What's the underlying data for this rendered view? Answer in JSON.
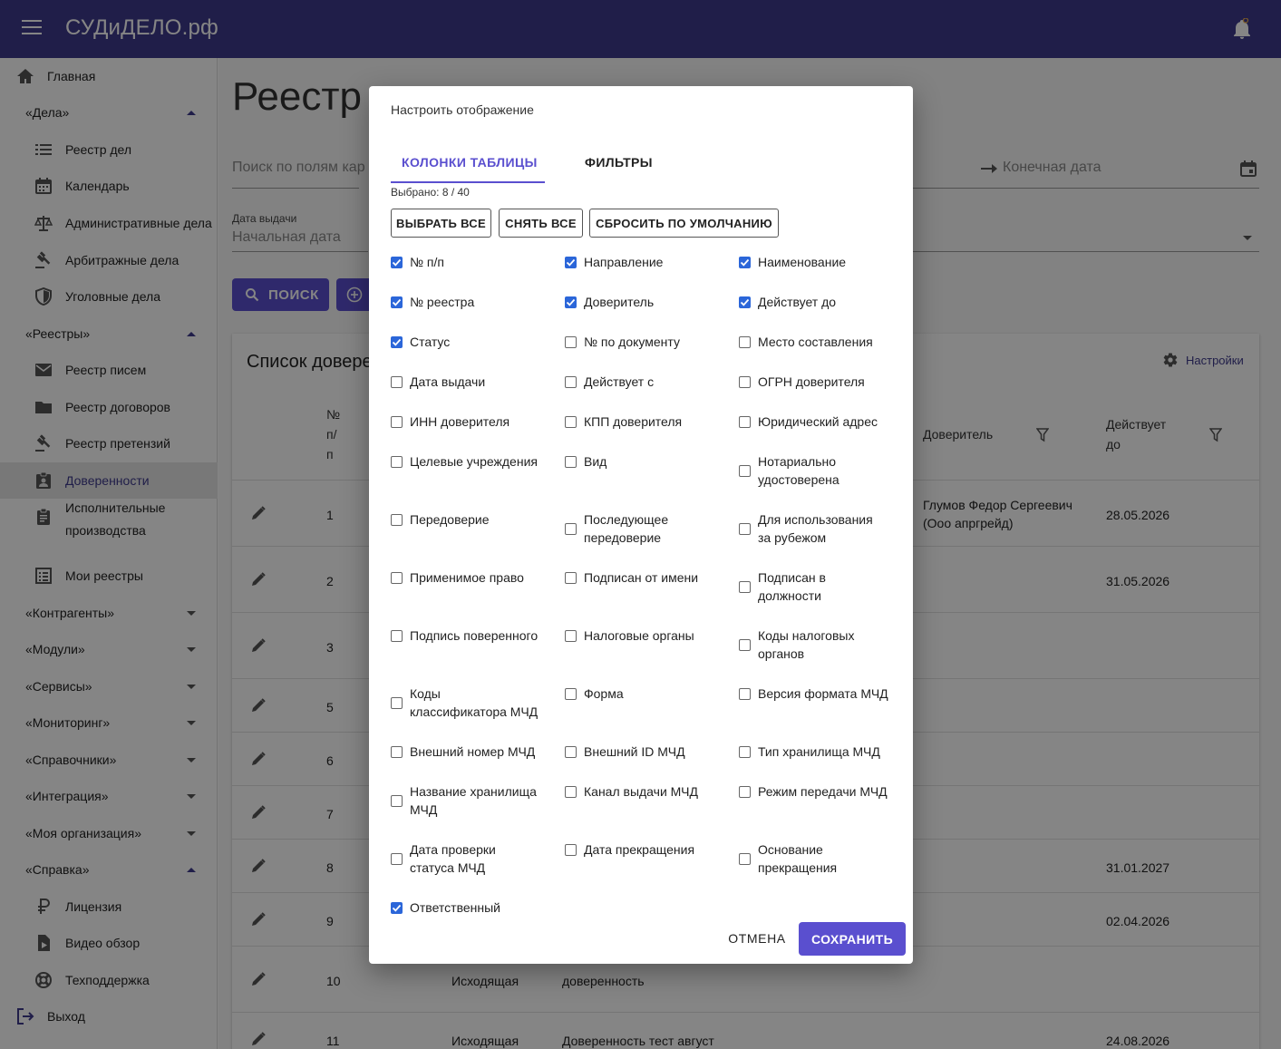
{
  "app": {
    "title": "СУДиДЕЛО.рф"
  },
  "sidebar": {
    "items": [
      {
        "label": "Главная",
        "icon": "home-icon"
      },
      {
        "label": "«Дела»",
        "icon": ""
      },
      {
        "label": "Реестр дел",
        "icon": "list-icon"
      },
      {
        "label": "Календарь",
        "icon": "calendar-icon"
      },
      {
        "label": "Административные дела",
        "icon": "scales-icon"
      },
      {
        "label": "Арбитражные дела",
        "icon": "gavel-icon"
      },
      {
        "label": "Уголовные дела",
        "icon": "shield-icon"
      },
      {
        "label": "«Реестры»",
        "icon": ""
      },
      {
        "label": "Реестр писем",
        "icon": "mail-icon"
      },
      {
        "label": "Реестр договоров",
        "icon": "folder-icon"
      },
      {
        "label": "Реестр претензий",
        "icon": "gavel-icon"
      },
      {
        "label": "Доверенности",
        "icon": "badge-icon"
      },
      {
        "label": "Исполнительные\nпроизводства",
        "icon": "clipboard-icon"
      },
      {
        "label": "Мои реестры",
        "icon": "list-box-icon"
      },
      {
        "label": "«Контрагенты»",
        "icon": ""
      },
      {
        "label": "«Модули»",
        "icon": ""
      },
      {
        "label": "«Сервисы»",
        "icon": ""
      },
      {
        "label": "«Мониторинг»",
        "icon": ""
      },
      {
        "label": "«Справочники»",
        "icon": ""
      },
      {
        "label": "«Интеграция»",
        "icon": ""
      },
      {
        "label": "«Моя организация»",
        "icon": ""
      },
      {
        "label": "«Справка»",
        "icon": ""
      },
      {
        "label": "Лицензия",
        "icon": "ruble-icon"
      },
      {
        "label": "Видео обзор",
        "icon": "video-file-icon"
      },
      {
        "label": "Техподдержка",
        "icon": "lifebuoy-icon"
      },
      {
        "label": "Выход",
        "icon": "logout-icon"
      }
    ]
  },
  "main": {
    "title": "Реестр д",
    "search_placeholder": "Поиск по полям кар",
    "end_date_placeholder": "Конечная дата",
    "issue_date_label": "Дата выдачи",
    "start_date_placeholder": "Начальная дата",
    "search_button": "ПОИСК",
    "list_title": "Список довере",
    "settings_link": "Настройки",
    "columns": {
      "num": "№\nп/\nп",
      "principal": "Доверитель",
      "valid_until": "Действует\nдо"
    },
    "rows": [
      {
        "num": "1",
        "direction": "",
        "name": "",
        "principal": "Глумов Федор Сергеевич\n(Ооо апргрейд)",
        "valid_until": "28.05.2026"
      },
      {
        "num": "2",
        "direction": "",
        "name": "",
        "principal": "",
        "valid_until": "31.05.2026"
      },
      {
        "num": "3",
        "direction": "",
        "name": "",
        "principal": "",
        "valid_until": ""
      },
      {
        "num": "5",
        "direction": "",
        "name": "",
        "principal": "",
        "valid_until": ""
      },
      {
        "num": "6",
        "direction": "",
        "name": "",
        "principal": "",
        "valid_until": ""
      },
      {
        "num": "7",
        "direction": "",
        "name": "",
        "principal": "",
        "valid_until": ""
      },
      {
        "num": "8",
        "direction": "",
        "name": "",
        "principal": "",
        "valid_until": "31.01.2027"
      },
      {
        "num": "9",
        "direction": "",
        "name": "",
        "principal": "",
        "valid_until": "02.04.2026"
      },
      {
        "num": "10",
        "direction": "Исходящая",
        "name": "доверенность",
        "principal": "",
        "valid_until": ""
      },
      {
        "num": "11",
        "direction": "Исходящая",
        "name": "Доверенность тест август",
        "principal": "",
        "valid_until": "24.08.2026"
      }
    ]
  },
  "dialog": {
    "title": "Настроить отображение",
    "tabs": [
      "КОЛОНКИ ТАБЛИЦЫ",
      "ФИЛЬТРЫ"
    ],
    "selected_text": "Выбрано: 8 / 40",
    "buttons": {
      "select_all": "ВЫБРАТЬ ВСЕ",
      "clear_all": "СНЯТЬ ВСЕ",
      "reset": "СБРОСИТЬ ПО УМОЛЧАНИЮ",
      "cancel": "ОТМЕНА",
      "save": "СОХРАНИТЬ"
    },
    "columns": [
      {
        "label": "№ п/п",
        "checked": true
      },
      {
        "label": "Направление",
        "checked": true
      },
      {
        "label": "Наименование",
        "checked": true
      },
      {
        "label": "№ реестра",
        "checked": true
      },
      {
        "label": "Доверитель",
        "checked": true
      },
      {
        "label": "Действует до",
        "checked": true
      },
      {
        "label": "Статус",
        "checked": true
      },
      {
        "label": "№ по документу",
        "checked": false
      },
      {
        "label": "Место составления",
        "checked": false
      },
      {
        "label": "Дата выдачи",
        "checked": false
      },
      {
        "label": "Действует с",
        "checked": false
      },
      {
        "label": "ОГРН доверителя",
        "checked": false
      },
      {
        "label": "ИНН доверителя",
        "checked": false
      },
      {
        "label": "КПП доверителя",
        "checked": false
      },
      {
        "label": "Юридический адрес",
        "checked": false
      },
      {
        "label": "Целевые учреждения",
        "checked": false
      },
      {
        "label": "Вид",
        "checked": false
      },
      {
        "label": "Нотариально\nудостоверена",
        "checked": false
      },
      {
        "label": "Передоверие",
        "checked": false
      },
      {
        "label": "Последующее\nпередоверие",
        "checked": false
      },
      {
        "label": "Для использования\nза рубежом",
        "checked": false
      },
      {
        "label": "Применимое право",
        "checked": false
      },
      {
        "label": "Подписан от имени",
        "checked": false
      },
      {
        "label": "Подписан в\nдолжности",
        "checked": false
      },
      {
        "label": "Подпись поверенного",
        "checked": false
      },
      {
        "label": "Налоговые органы",
        "checked": false
      },
      {
        "label": "Коды налоговых\nорганов",
        "checked": false
      },
      {
        "label": "Коды\nклассификатора МЧД",
        "checked": false
      },
      {
        "label": "Форма",
        "checked": false
      },
      {
        "label": "Версия формата МЧД",
        "checked": false
      },
      {
        "label": "Внешний номер МЧД",
        "checked": false
      },
      {
        "label": "Внешний ID МЧД",
        "checked": false
      },
      {
        "label": "Тип хранилища МЧД",
        "checked": false
      },
      {
        "label": "Название хранилища\nМЧД",
        "checked": false
      },
      {
        "label": "Канал выдачи МЧД",
        "checked": false
      },
      {
        "label": "Режим передачи МЧД",
        "checked": false
      },
      {
        "label": "Дата проверки\nстатуса МЧД",
        "checked": false
      },
      {
        "label": "Дата прекращения",
        "checked": false
      },
      {
        "label": "Основание\nпрекращения",
        "checked": false
      },
      {
        "label": "Ответственный",
        "checked": true
      }
    ]
  },
  "colors": {
    "appbar": "#3f3a8c",
    "accent": "#5a4fcf",
    "checkbox": "#2b66d9"
  }
}
